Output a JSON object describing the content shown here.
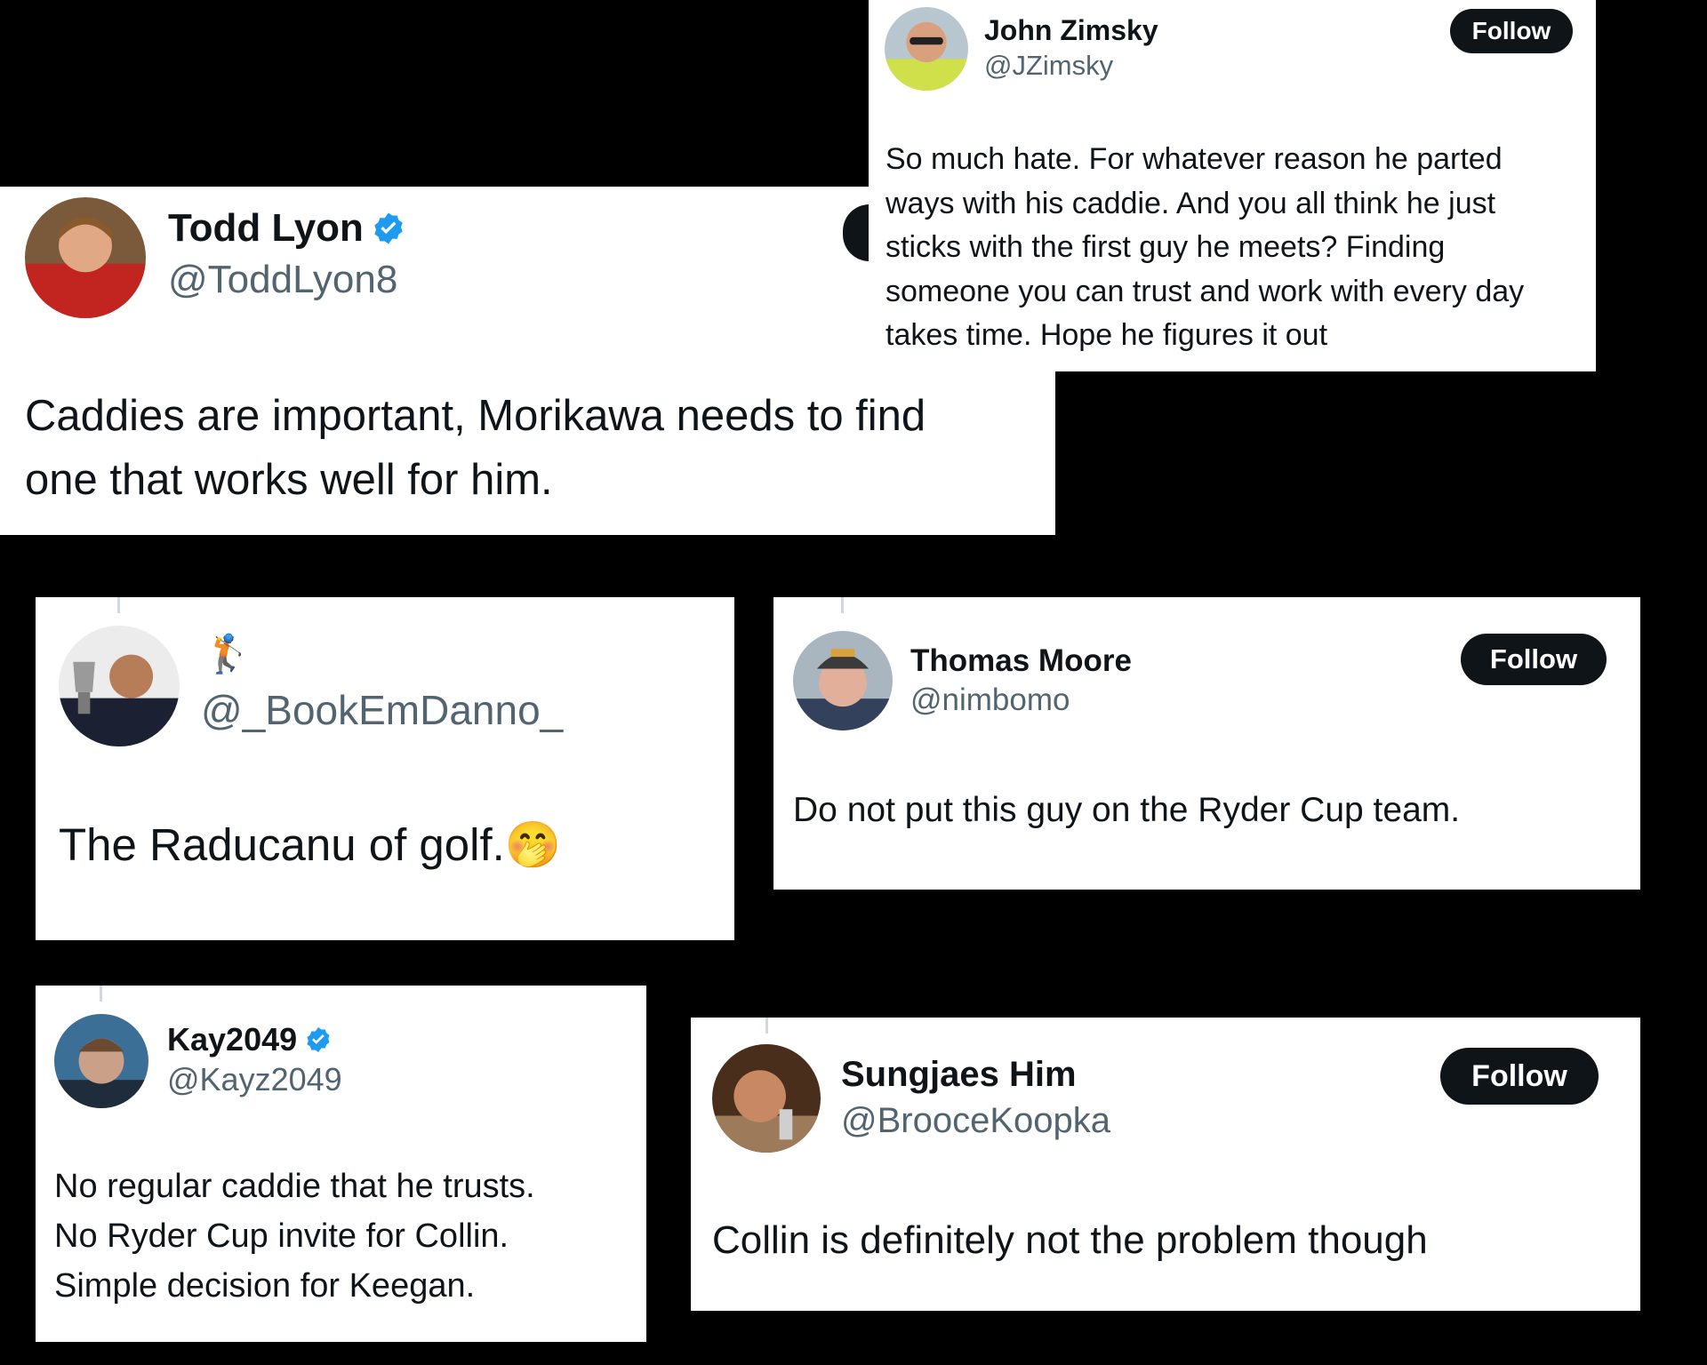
{
  "tweets": {
    "john": {
      "name": "John Zimsky",
      "handle": "@JZimsky",
      "follow_label": "Follow",
      "lines": [
        "So much hate. For whatever reason he parted",
        "ways with his caddie. And you all think he just",
        "sticks with the first guy he meets? Finding",
        "someone you can trust and work with every day",
        "takes time.  Hope he figures it out"
      ]
    },
    "todd": {
      "name": "Todd Lyon",
      "handle": "@ToddLyon8",
      "lines": [
        "Caddies are important, Morikawa needs to find",
        "one that works well for him."
      ]
    },
    "bookem": {
      "name_emoji": "🏌",
      "handle": "@_BookEmDanno_",
      "text": "The Raducanu of golf.",
      "emoji": "🤭"
    },
    "thomas": {
      "name": "Thomas Moore",
      "handle": "@nimbomo",
      "follow_label": "Follow",
      "text": "Do not put this guy on the Ryder Cup team."
    },
    "kay": {
      "name": "Kay2049",
      "handle": "@Kayz2049",
      "lines": [
        "No regular caddie that he trusts.",
        "No Ryder Cup invite for Collin.",
        "Simple decision for Keegan."
      ]
    },
    "sungjae": {
      "name": "Sungjaes Him",
      "handle": "@BrooceKoopka",
      "follow_label": "Follow",
      "text": "Collin is definitely not the problem though"
    }
  },
  "colors": {
    "verified": "#1d9bf0",
    "follow_bg": "#0f1419",
    "handle": "#536471"
  },
  "icons": {
    "verified": "verified-badge-icon"
  }
}
